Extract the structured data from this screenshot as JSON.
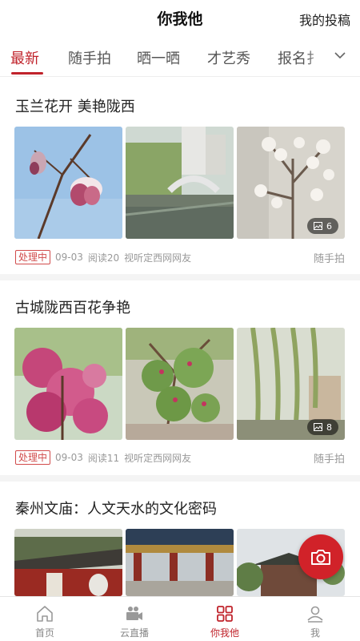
{
  "header": {
    "title": "你我他",
    "submit_label": "我的投稿"
  },
  "tabs": [
    {
      "label": "最新",
      "active": true
    },
    {
      "label": "随手拍",
      "active": false
    },
    {
      "label": "晒一晒",
      "active": false
    },
    {
      "label": "才艺秀",
      "active": false
    },
    {
      "label": "报名扌",
      "active": false
    }
  ],
  "posts": [
    {
      "title": "玉兰花开 美艳陇西",
      "status": "处理中",
      "date": "09-03",
      "reads": "阅读20",
      "author": "视听定西网网友",
      "category": "随手拍",
      "image_count": "6"
    },
    {
      "title": "古城陇西百花争艳",
      "status": "处理中",
      "date": "09-03",
      "reads": "阅读11",
      "author": "视听定西网网友",
      "category": "随手拍",
      "image_count": "8"
    },
    {
      "title": "秦州文庙：人文天水的文化密码"
    }
  ],
  "bottom_nav": [
    {
      "label": "首页",
      "icon": "home-icon",
      "active": false
    },
    {
      "label": "云直播",
      "icon": "video-camera-icon",
      "active": false
    },
    {
      "label": "你我他",
      "icon": "grid-icon",
      "active": true
    },
    {
      "label": "我",
      "icon": "user-icon",
      "active": false
    }
  ],
  "colors": {
    "accent": "#c0232b",
    "fab": "#d12229"
  }
}
